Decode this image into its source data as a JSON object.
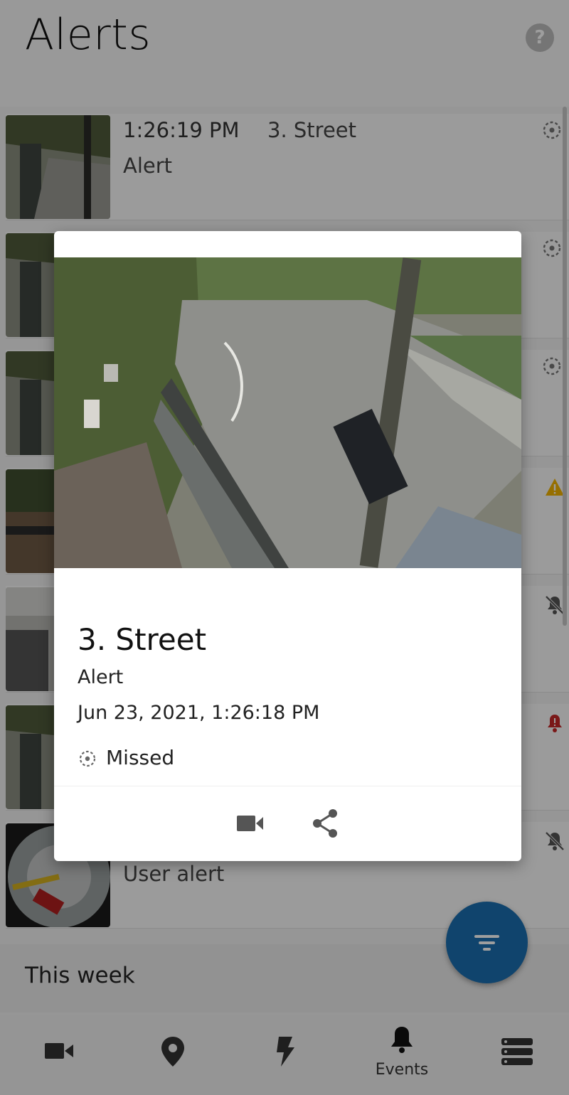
{
  "header": {
    "title": "Alerts",
    "help_label": "?"
  },
  "list": {
    "rows": [
      {
        "time": "1:26:19 PM",
        "camera": "3. Street",
        "type": "Alert",
        "status_icon": "missed-icon"
      },
      {
        "time": "",
        "camera": "",
        "type": "",
        "status_icon": "missed-icon"
      },
      {
        "time": "",
        "camera": "",
        "type": "",
        "status_icon": "missed-icon"
      },
      {
        "time": "",
        "camera": "",
        "type": "",
        "status_icon": "warning-icon"
      },
      {
        "time": "",
        "camera": "",
        "type": "",
        "status_icon": "bell-off-icon"
      },
      {
        "time": "",
        "camera": "",
        "type": "",
        "status_icon": "bell-alert-icon"
      },
      {
        "time": "",
        "camera": "",
        "type": "User alert",
        "status_icon": "bell-off-icon"
      }
    ],
    "section_label": "This week"
  },
  "modal": {
    "camera": "3. Street",
    "type": "Alert",
    "datetime": "Jun 23, 2021, 1:26:18 PM",
    "status": "Missed",
    "actions": [
      "video-icon",
      "share-icon"
    ]
  },
  "bottom_nav": {
    "items": [
      {
        "icon": "camera-icon",
        "label": ""
      },
      {
        "icon": "map-pin-icon",
        "label": ""
      },
      {
        "icon": "lightning-icon",
        "label": ""
      },
      {
        "icon": "bell-icon",
        "label": "Events"
      },
      {
        "icon": "server-icon",
        "label": ""
      }
    ]
  },
  "colors": {
    "accent": "#1a6fb0",
    "warning": "#f2b400",
    "alert": "#c62828",
    "icon_gray": "#555555"
  }
}
